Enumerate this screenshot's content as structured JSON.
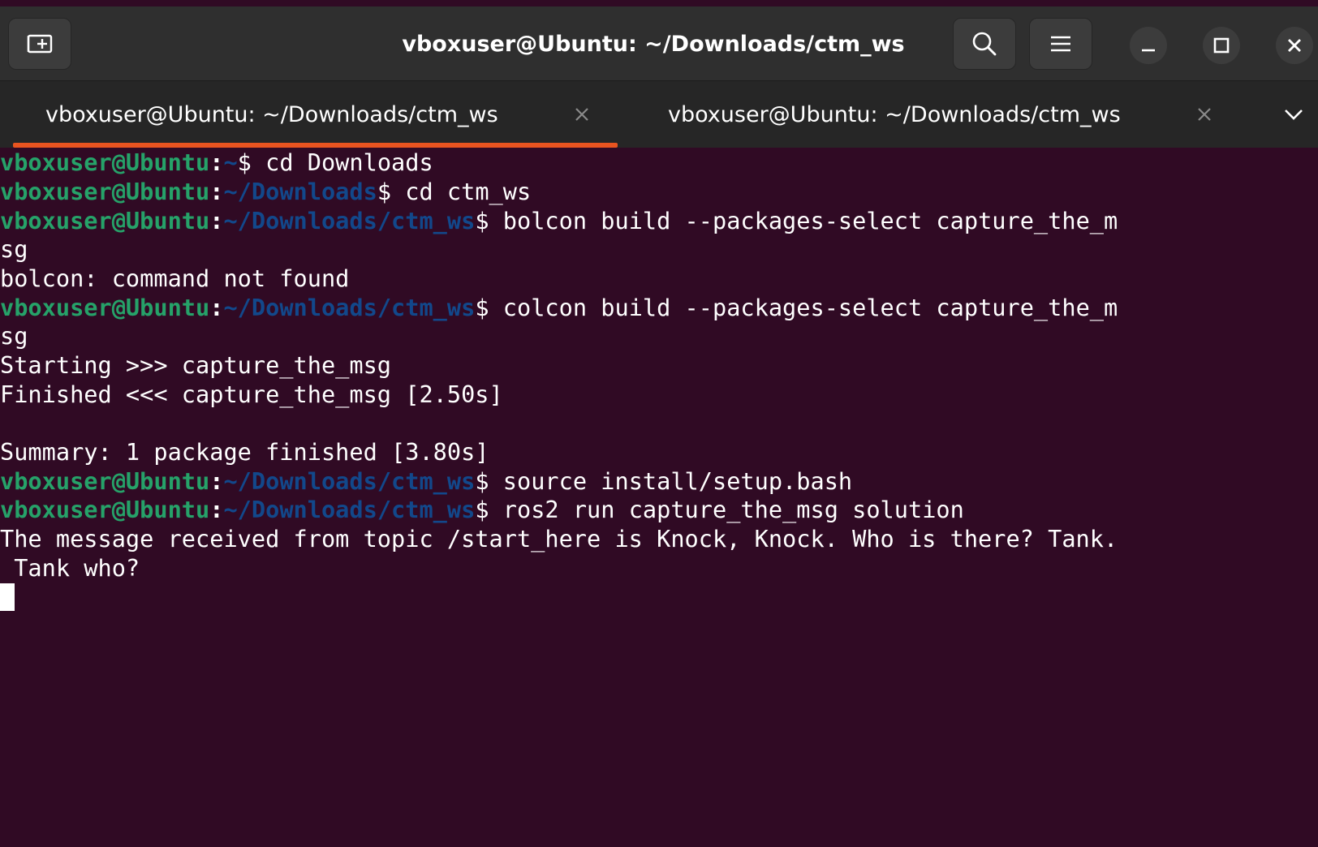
{
  "window": {
    "title": "vboxuser@Ubuntu: ~/Downloads/ctm_ws",
    "icons": {
      "new_tab": "new-tab-icon",
      "search": "search-icon",
      "menu": "hamburger-menu-icon",
      "minimize": "minimize-icon",
      "maximize": "maximize-icon",
      "close": "close-icon"
    }
  },
  "tabs": [
    {
      "label": "vboxuser@Ubuntu: ~/Downloads/ctm_ws",
      "active": true
    },
    {
      "label": "vboxuser@Ubuntu: ~/Downloads/ctm_ws",
      "active": false
    }
  ],
  "colors": {
    "terminal_bg": "#300a24",
    "prompt_user": "#26a269",
    "prompt_path": "#12488b",
    "accent": "#e95420"
  },
  "terminal": {
    "lines": [
      {
        "user": "vboxuser@Ubuntu",
        "path": "~",
        "cmd": "$ cd Downloads"
      },
      {
        "user": "vboxuser@Ubuntu",
        "path": "~/Downloads",
        "cmd": "$ cd ctm_ws"
      },
      {
        "user": "vboxuser@Ubuntu",
        "path": "~/Downloads/ctm_ws",
        "cmd": "$ bolcon build --packages-select capture_the_m"
      },
      {
        "text": "sg"
      },
      {
        "text": "bolcon: command not found"
      },
      {
        "user": "vboxuser@Ubuntu",
        "path": "~/Downloads/ctm_ws",
        "cmd": "$ colcon build --packages-select capture_the_m"
      },
      {
        "text": "sg"
      },
      {
        "text": "Starting >>> capture_the_msg"
      },
      {
        "text": "Finished <<< capture_the_msg [2.50s]"
      },
      {
        "text": ""
      },
      {
        "text": "Summary: 1 package finished [3.80s]"
      },
      {
        "user": "vboxuser@Ubuntu",
        "path": "~/Downloads/ctm_ws",
        "cmd": "$ source install/setup.bash"
      },
      {
        "user": "vboxuser@Ubuntu",
        "path": "~/Downloads/ctm_ws",
        "cmd": "$ ros2 run capture_the_msg solution"
      },
      {
        "text": "The message received from topic /start_here is Knock, Knock. Who is there? Tank."
      },
      {
        "text": " Tank who?"
      }
    ]
  }
}
